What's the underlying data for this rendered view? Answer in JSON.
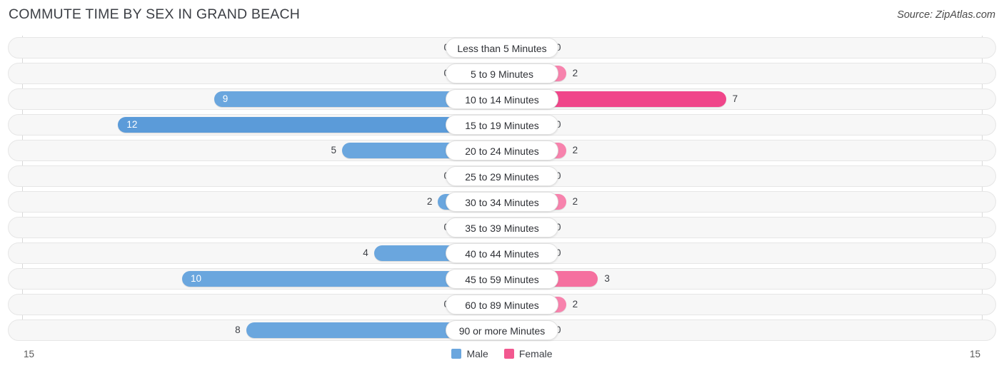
{
  "header": {
    "title": "COMMUTE TIME BY SEX IN GRAND BEACH",
    "source": "Source: ZipAtlas.com"
  },
  "axis": {
    "left_max_label": "15",
    "right_max_label": "15"
  },
  "legend": {
    "items": [
      {
        "label": "Male",
        "color": "#6aa6de"
      },
      {
        "label": "Female",
        "color": "#f2588f"
      }
    ]
  },
  "colors": {
    "male_strong": "#6aa6de",
    "male_light": "#a8c9ec",
    "female_strong": "#f2588f",
    "female_light": "#f8a9c4",
    "track": "#f7f7f7",
    "track_border": "#e6e6e6",
    "gridline": "#d8d8d8"
  },
  "chart_data": {
    "type": "bar",
    "subtype": "diverging-bidirectional",
    "title": "COMMUTE TIME BY SEX IN GRAND BEACH",
    "xlabel": "",
    "ylabel": "",
    "xlim": [
      15,
      15
    ],
    "grid": true,
    "legend_position": "bottom-center",
    "categories": [
      "Less than 5 Minutes",
      "5 to 9 Minutes",
      "10 to 14 Minutes",
      "15 to 19 Minutes",
      "20 to 24 Minutes",
      "25 to 29 Minutes",
      "30 to 34 Minutes",
      "35 to 39 Minutes",
      "40 to 44 Minutes",
      "45 to 59 Minutes",
      "60 to 89 Minutes",
      "90 or more Minutes"
    ],
    "series": [
      {
        "name": "Male",
        "direction": "left",
        "values": [
          0,
          0,
          9,
          12,
          5,
          0,
          2,
          0,
          4,
          10,
          0,
          8
        ]
      },
      {
        "name": "Female",
        "direction": "right",
        "values": [
          0,
          2,
          7,
          0,
          2,
          0,
          2,
          0,
          0,
          3,
          2,
          0
        ]
      }
    ]
  },
  "rows": [
    {
      "label": "Less than 5 Minutes",
      "male": "0",
      "female": "0"
    },
    {
      "label": "5 to 9 Minutes",
      "male": "0",
      "female": "2"
    },
    {
      "label": "10 to 14 Minutes",
      "male": "9",
      "female": "7"
    },
    {
      "label": "15 to 19 Minutes",
      "male": "12",
      "female": "0"
    },
    {
      "label": "20 to 24 Minutes",
      "male": "5",
      "female": "2"
    },
    {
      "label": "25 to 29 Minutes",
      "male": "0",
      "female": "0"
    },
    {
      "label": "30 to 34 Minutes",
      "male": "2",
      "female": "2"
    },
    {
      "label": "35 to 39 Minutes",
      "male": "0",
      "female": "0"
    },
    {
      "label": "40 to 44 Minutes",
      "male": "4",
      "female": "0"
    },
    {
      "label": "45 to 59 Minutes",
      "male": "10",
      "female": "3"
    },
    {
      "label": "60 to 89 Minutes",
      "male": "0",
      "female": "2"
    },
    {
      "label": "90 or more Minutes",
      "male": "8",
      "female": "0"
    }
  ]
}
